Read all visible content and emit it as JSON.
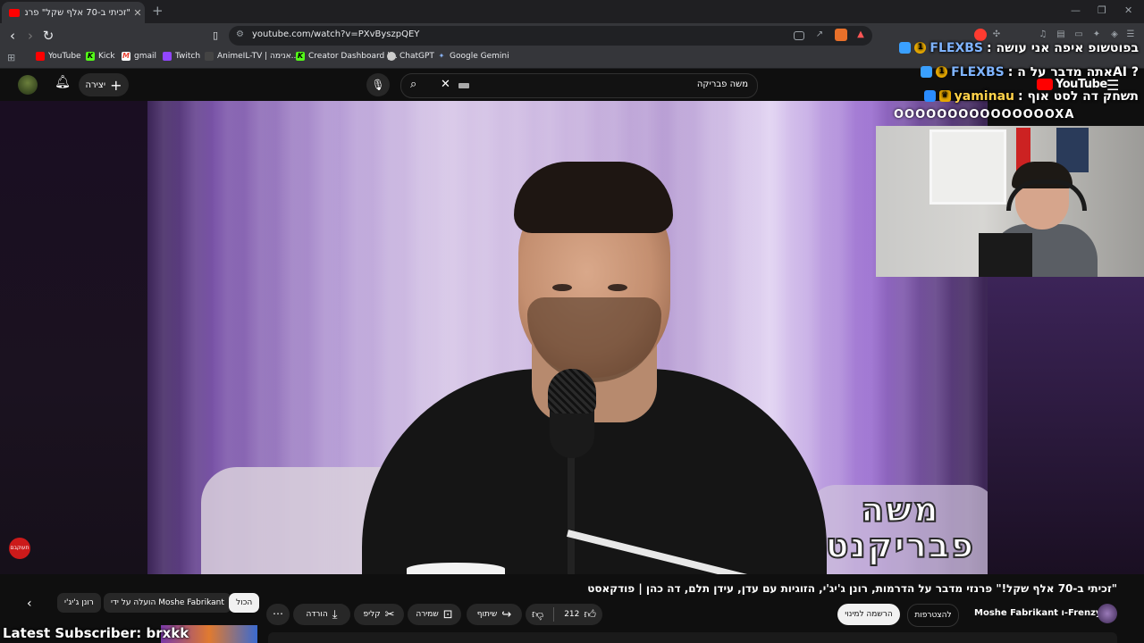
{
  "browser": {
    "tab_title": "\"זכיתי ב-70 אלף שקל\" פרנזי מד",
    "tab_close": "✕",
    "new_tab": "+",
    "url": "youtube.com/watch?v=PXvByszpQEY",
    "window_minimize": "—",
    "window_restore": "❐",
    "window_close": "✕"
  },
  "bookmarks": [
    {
      "label": "YouTube",
      "icon": "youtube-icon",
      "color": "#ff0000"
    },
    {
      "label": "Kick",
      "icon": "kick-icon",
      "color": "#53fc18"
    },
    {
      "label": "gmail",
      "icon": "gmail-icon",
      "color": "#ea4335"
    },
    {
      "label": "Twitch",
      "icon": "twitch-icon",
      "color": "#9146ff"
    },
    {
      "label": "AnimeIL-TV | אנימה...",
      "icon": "animeil-icon",
      "color": "#444"
    },
    {
      "label": "Creator Dashboard |...",
      "icon": "kick-icon",
      "color": "#53fc18"
    },
    {
      "label": "ChatGPT",
      "icon": "chatgpt-icon",
      "color": "#ccc"
    },
    {
      "label": "Google Gemini",
      "icon": "gemini-icon",
      "color": "#8ab4f8"
    }
  ],
  "youtube": {
    "create_label": "יצירה",
    "search_query": "משה פבריקה",
    "video_title": "\"זכיתי ב-70 אלף שקל!\" פרנזי מדבר על הדרמות, רונן ג'יג'י, הזוגיות עם עדן, עידן תלם, דה כהן | פודקאסט",
    "overlay_name_line1": "משה",
    "overlay_name_line2": "פבריקנט",
    "channel_name": "Moshe Fabrikant ו-Frenzy",
    "join_label": "להצטרפות",
    "subscribe_label": "הרשמה למינוי",
    "like_count": "212",
    "share_label": "שיתוף",
    "save_label": "שמירה",
    "clip_label": "קליפ",
    "download_label": "הורדה",
    "more_label": "⋯",
    "chips": {
      "all": "הכול",
      "uploaded_by": "הועלה על ידי Moshe Fabrikant",
      "ronen": "רונן ג'יג'י"
    }
  },
  "stream_overlay": {
    "chat": [
      {
        "user": "FLEXBS",
        "message": "בפוטשופ איפה אני עושה",
        "badge_color": "#3aa0ff"
      },
      {
        "user": "FLEXBS",
        "message": "? AIאתה מדבר על ה",
        "badge_color": "#3aa0ff"
      },
      {
        "user": "yaminau",
        "message": "תשחק דה לסט אוף",
        "badge_color": "#2a8cff"
      }
    ],
    "chat_extra": "OOOOOOOOOOOOOOOXA",
    "yt_logo_text": "YouTube",
    "latest_subscriber": "Latest Subscriber: brxkk",
    "red_badge": "תעוקבם"
  },
  "colors": {
    "accent_red": "#ff0000",
    "chat_user": "#7fb4ff",
    "chat_user_alt": "#ffd24a"
  }
}
